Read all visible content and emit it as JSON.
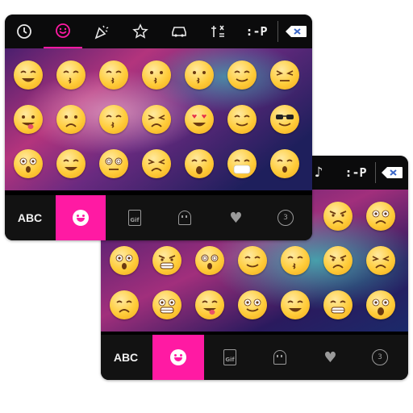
{
  "front": {
    "toolbar": {
      "kaomoji_label": ":-P",
      "icons": [
        "clock-icon",
        "smiley-icon",
        "party-icon",
        "star-icon",
        "car-icon",
        "symbols-icon"
      ]
    },
    "emojis": [
      "grinning",
      "kiss-lipstick",
      "kiss-face",
      "wink-bowtie",
      "love-face",
      "angel",
      "unamused",
      "tongue-out",
      "worried-sweat",
      "kissing",
      "persevering",
      "heart-eyes",
      "smirk",
      "cool",
      "surprised",
      "laughing",
      "hypnotized",
      "frown",
      "crying",
      "masked",
      "sleepy"
    ],
    "bottombar": {
      "abc_label": "ABC",
      "gif_label": "Gif"
    }
  },
  "back": {
    "toolbar": {
      "kaomoji_label": ":-P"
    },
    "emojis": [
      "angry-symbols",
      "worried",
      "shocked",
      "furious",
      "dizzy-eyes",
      "smiling",
      "heart-kiss",
      "angry",
      "sad",
      "pensive",
      "fearful",
      "tongue-wink",
      "blushing",
      "joy-tears",
      "grimace-bowtie",
      "scream"
    ],
    "bottombar": {
      "abc_label": "ABC",
      "gif_label": "Gif"
    }
  },
  "colors": {
    "accent": "#ff1aa3",
    "bar": "#0b0b0c",
    "emoji": "#ffcc3a"
  }
}
